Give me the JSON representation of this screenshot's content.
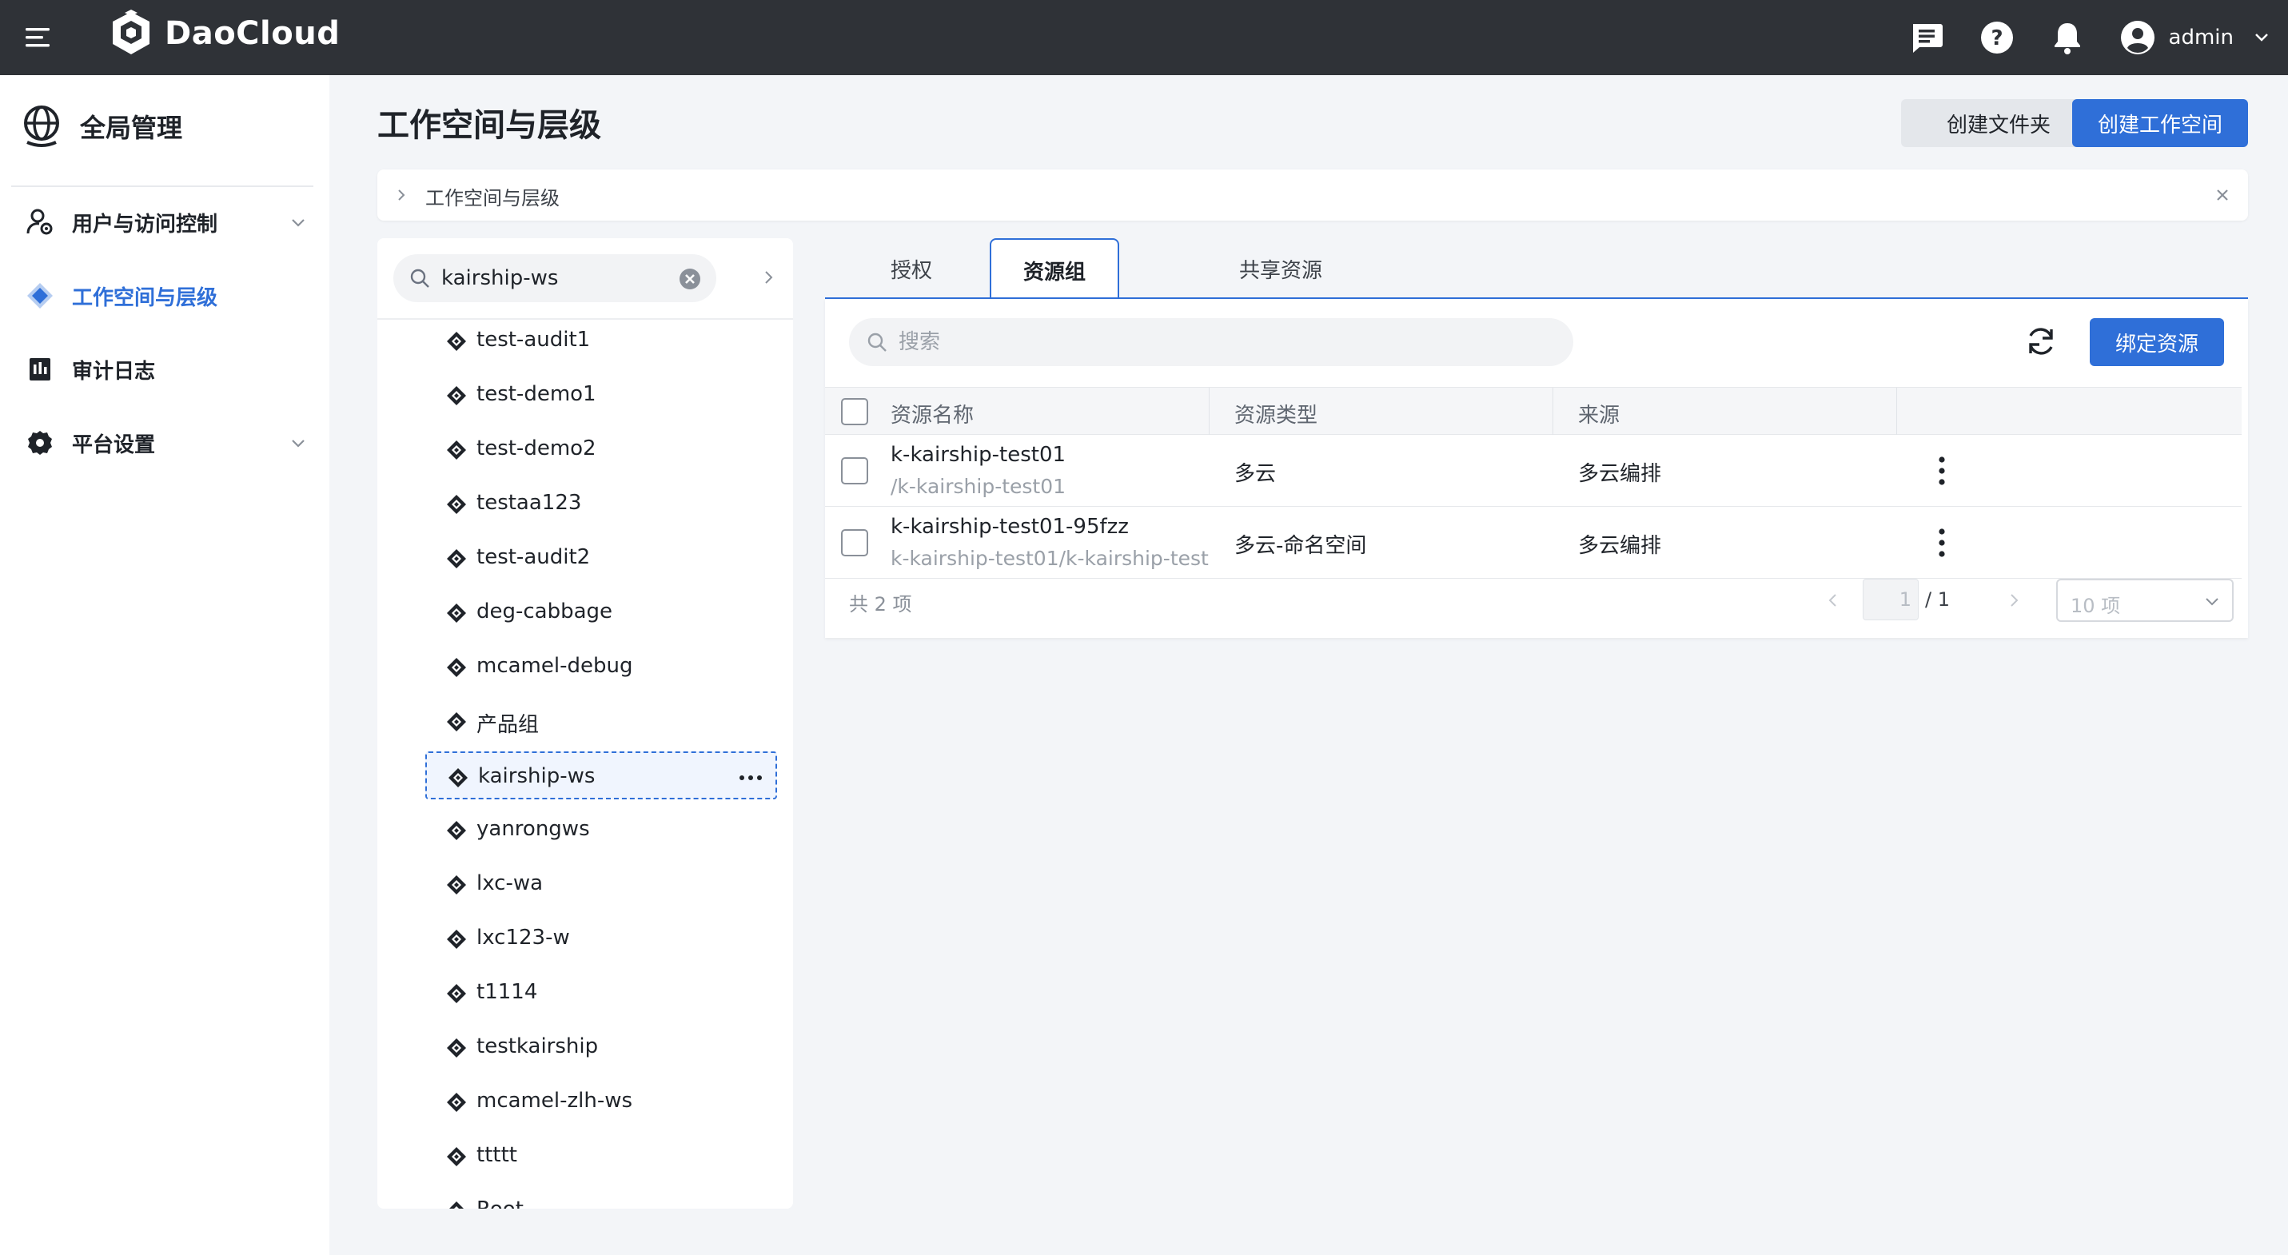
{
  "app": {
    "brand": "DaoCloud",
    "user": "admin"
  },
  "colors": {
    "accent": "#2f6fd8",
    "topbar": "#2f3237",
    "sidebar_bg": "#ffffff",
    "page_bg": "#f3f5f8"
  },
  "icons": {
    "menu": "hamburger-icon",
    "logo": "daocloud-cube-icon",
    "messages": "message-icon",
    "help": "help-icon",
    "notifications": "bell-icon",
    "avatar": "user-avatar-icon",
    "workspace_node": "workspace-diamond-icon",
    "refresh": "refresh-icon",
    "search": "search-icon"
  },
  "sidebar": {
    "title": "全局管理",
    "items": [
      {
        "label": "用户与访问控制",
        "has_children": true,
        "active": false
      },
      {
        "label": "工作空间与层级",
        "has_children": false,
        "active": true
      },
      {
        "label": "审计日志",
        "has_children": false,
        "active": false
      },
      {
        "label": "平台设置",
        "has_children": true,
        "active": false
      }
    ]
  },
  "main": {
    "title": "工作空间与层级",
    "actions": {
      "create_folder": "创建文件夹",
      "create_workspace": "创建工作空间"
    },
    "breadcrumb": "工作空间与层级"
  },
  "tree": {
    "search_value": "kairship-ws",
    "nodes": [
      "test-audit1",
      "test-demo1",
      "test-demo2",
      "testaa123",
      "test-audit2",
      "deg-cabbage",
      "mcamel-debug",
      "产品组",
      "kairship-ws",
      "yanrongws",
      "lxc-wa",
      "lxc123-w",
      "t1114",
      "testkairship",
      "mcamel-zlh-ws",
      "ttttt",
      "Root"
    ],
    "selected": "kairship-ws"
  },
  "tabs": [
    {
      "label": "授权",
      "active": false
    },
    {
      "label": "资源组",
      "active": true
    },
    {
      "label": "共享资源",
      "active": false
    }
  ],
  "resource": {
    "search_placeholder": "搜索",
    "bind_button": "绑定资源",
    "columns": [
      "资源名称",
      "资源类型",
      "来源"
    ],
    "rows": [
      {
        "name": "k-kairship-test01",
        "path": "/k-kairship-test01",
        "type": "多云",
        "source": "多云编排"
      },
      {
        "name": "k-kairship-test01-95fzz",
        "path": "k-kairship-test01/k-kairship-test",
        "type": "多云-命名空间",
        "source": "多云编排"
      }
    ],
    "total": "共 2 项",
    "page_current": "1",
    "page_total": "/ 1",
    "page_size": "10 项"
  }
}
